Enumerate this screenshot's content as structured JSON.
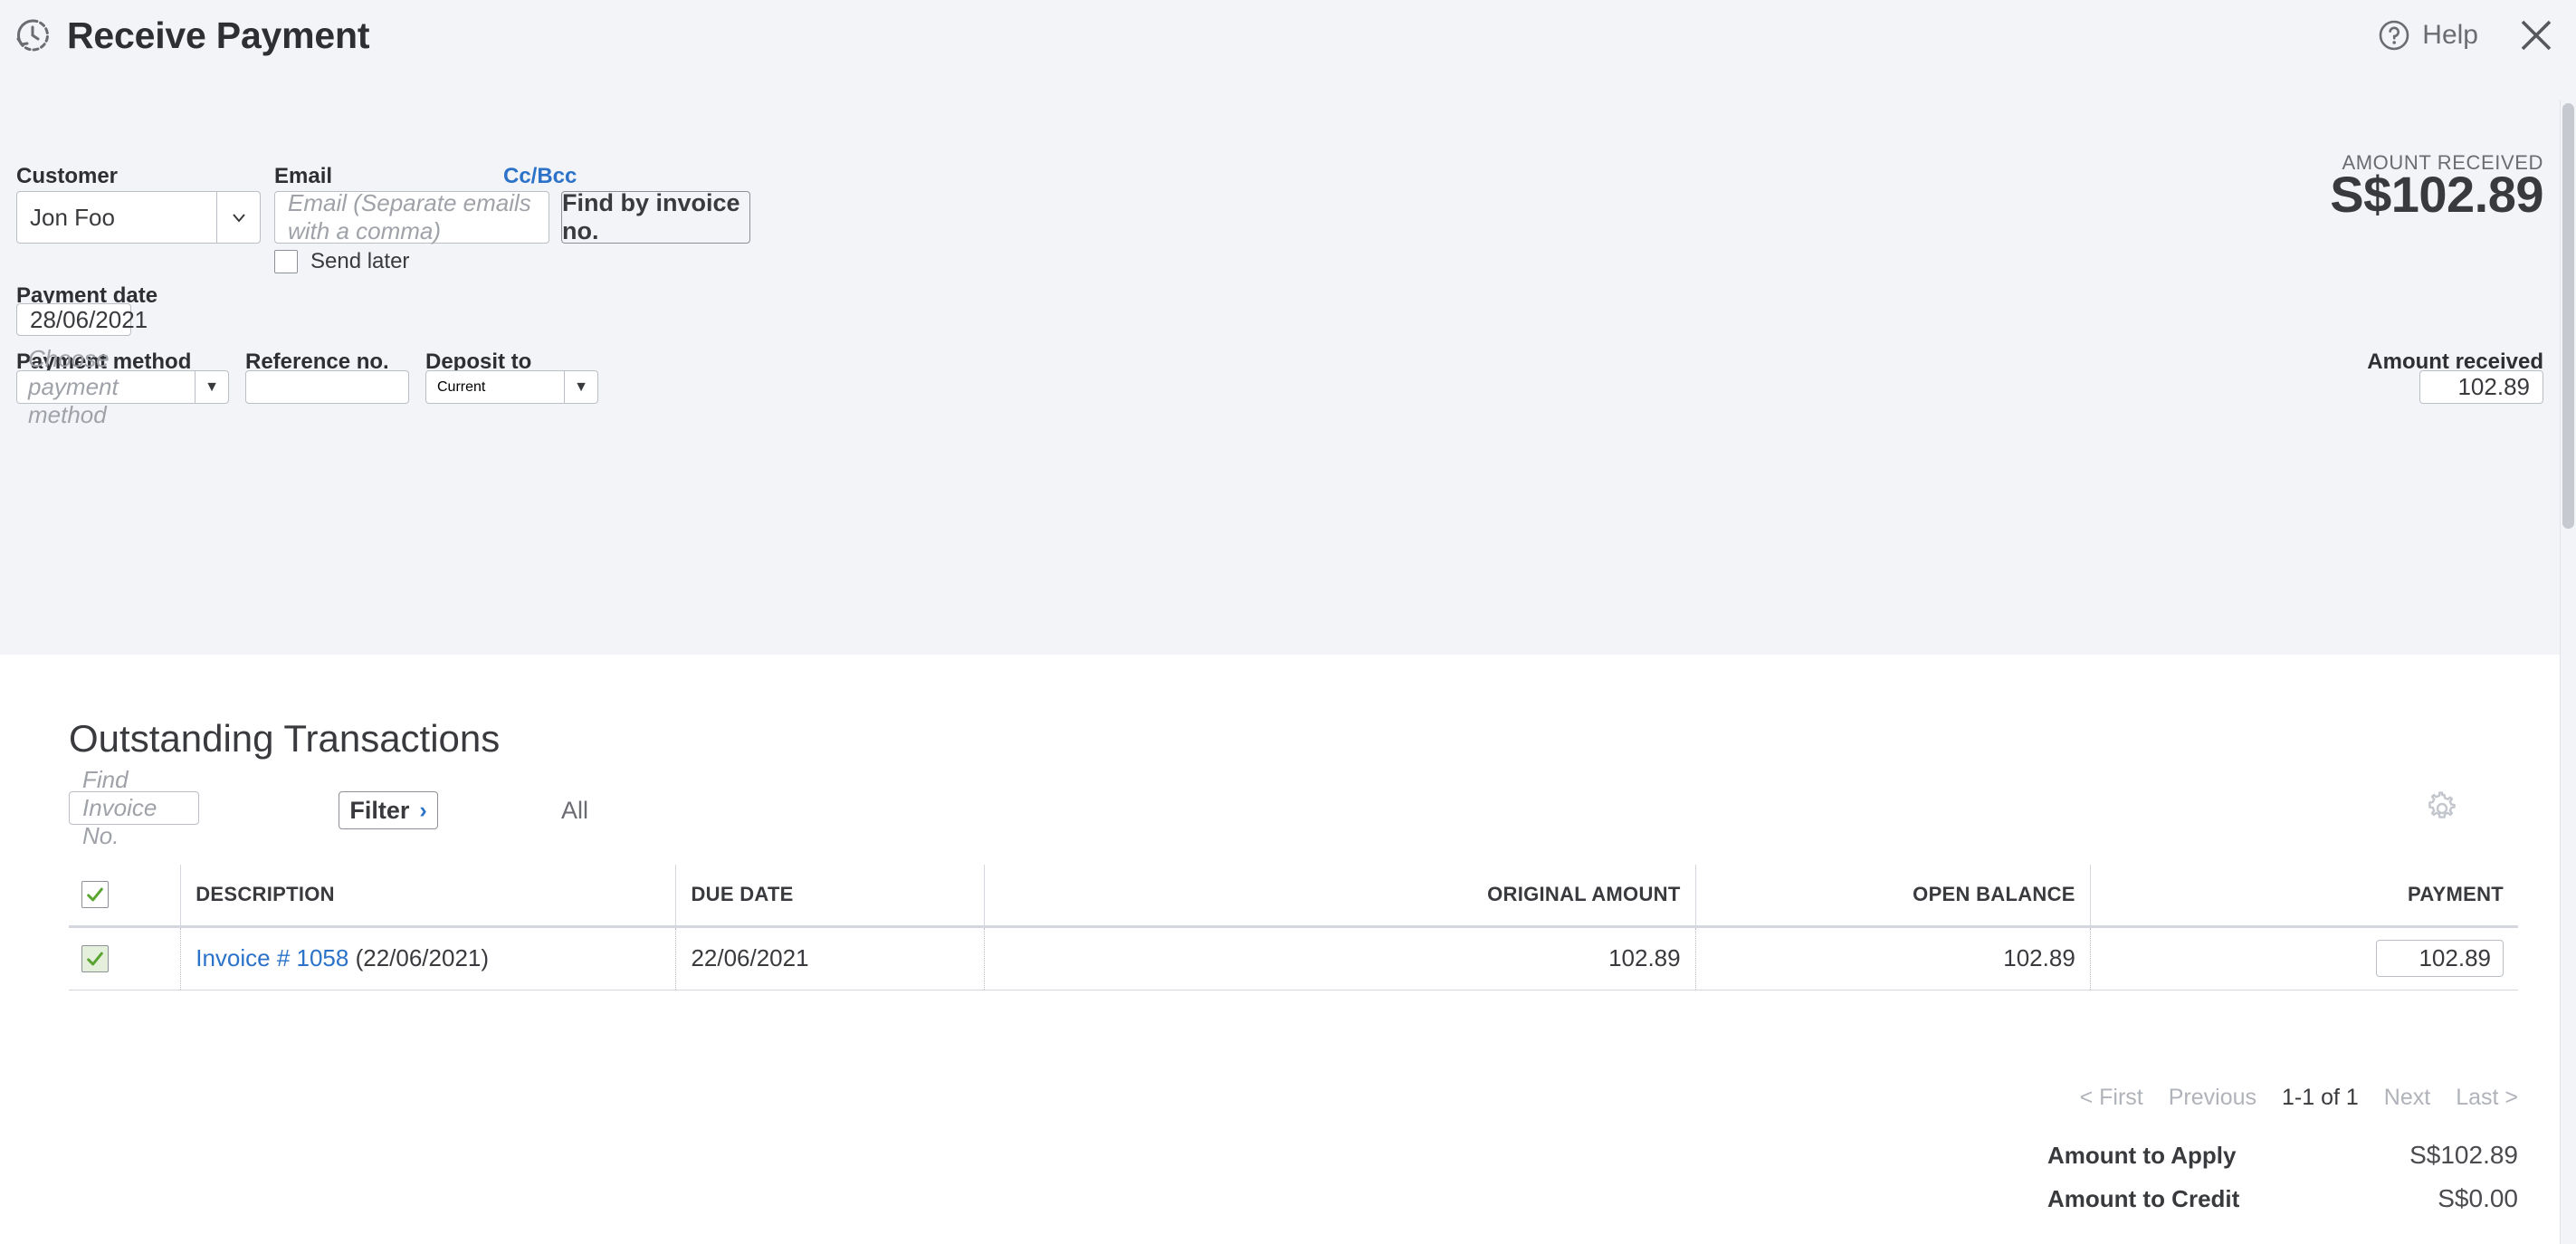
{
  "header": {
    "title": "Receive Payment",
    "clock_icon": "history-clock-icon",
    "help_label": "Help",
    "help_icon": "question-circle-icon",
    "close_icon": "close-x-icon"
  },
  "form": {
    "customer_label": "Customer",
    "customer_value": "Jon Foo",
    "email_label": "Email",
    "email_placeholder": "Email (Separate emails with a comma)",
    "cc_bcc_label": "Cc/Bcc",
    "send_later_label": "Send later",
    "find_by_invoice_label": "Find by invoice no.",
    "amount_received_caption": "AMOUNT RECEIVED",
    "amount_received_big": "S$102.89",
    "payment_date_label": "Payment date",
    "payment_date_value": "28/06/2021",
    "payment_method_label": "Payment method",
    "payment_method_placeholder": "Choose payment method",
    "reference_label": "Reference no.",
    "reference_value": "",
    "deposit_to_label": "Deposit to",
    "deposit_to_value": "Current",
    "amount_received_label": "Amount received",
    "amount_received_value": "102.89"
  },
  "outstanding": {
    "title": "Outstanding Transactions",
    "find_invoice_placeholder": "Find Invoice No.",
    "filter_label": "Filter",
    "filter_arrow": "›",
    "all_label": "All",
    "gear_icon": "gear-icon",
    "columns": [
      "DESCRIPTION",
      "DUE DATE",
      "ORIGINAL AMOUNT",
      "OPEN BALANCE",
      "PAYMENT"
    ],
    "rows": [
      {
        "selected": true,
        "description_link": "Invoice # 1058",
        "description_suffix": " (22/06/2021)",
        "due_date": "22/06/2021",
        "original_amount": "102.89",
        "open_balance": "102.89",
        "payment": "102.89"
      }
    ],
    "pagination": {
      "first": "< First",
      "previous": "Previous",
      "current": "1-1 of 1",
      "next": "Next",
      "last": "Last >"
    },
    "totals": [
      {
        "label": "Amount to Apply",
        "value": "S$102.89"
      },
      {
        "label": "Amount to Credit",
        "value": "S$0.00"
      }
    ]
  },
  "colors": {
    "panel_bg": "#f3f4f8",
    "link_blue": "#2b72c8",
    "check_green": "#5aa432",
    "text_dark": "#393a3d"
  }
}
